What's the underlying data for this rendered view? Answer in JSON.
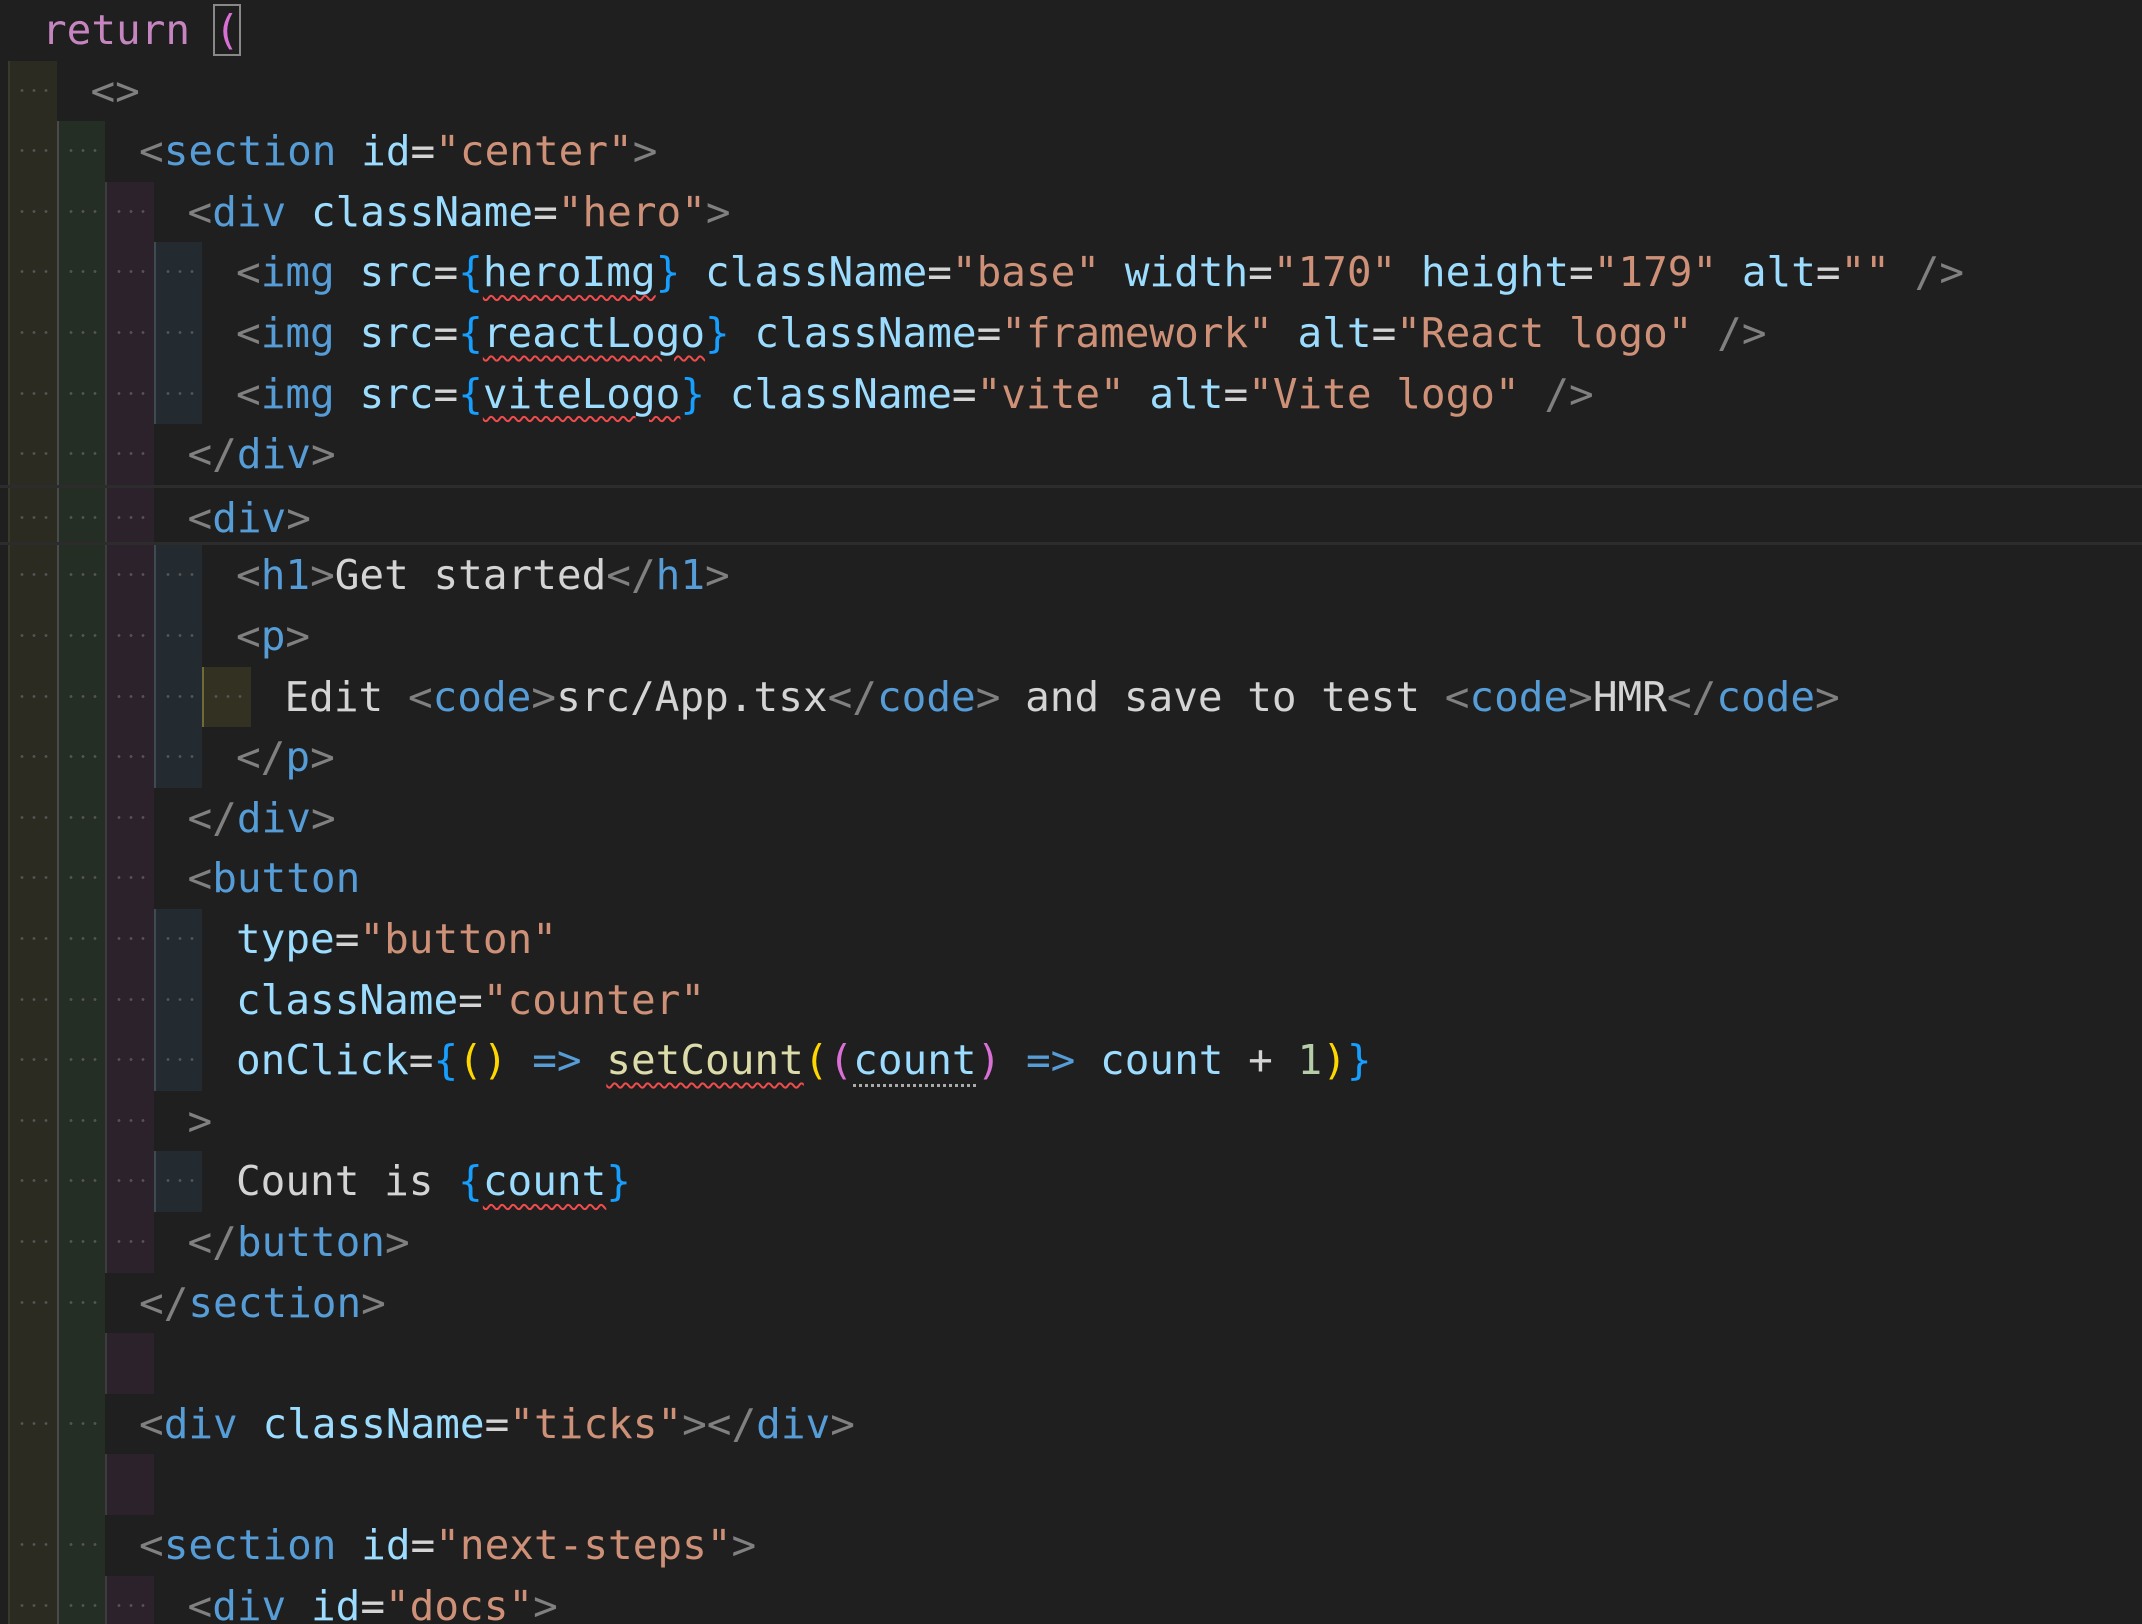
{
  "editor": {
    "language": "tsx",
    "colors": {
      "background": "#1f1f1f",
      "tag": "#569cd6",
      "attribute": "#9cdcfe",
      "string": "#ce9178",
      "keyword": "#c586c0",
      "function": "#dcdcaa",
      "number": "#b5cea8",
      "error_squiggle": "#f14c4c"
    },
    "lines": [
      {
        "indent": 0,
        "tokens": [
          {
            "t": "return",
            "c": "kw-return"
          },
          {
            "t": " ",
            "c": "ws"
          },
          {
            "t": "(",
            "c": "paren-magenta bracket-box"
          }
        ]
      },
      {
        "indent": 1,
        "tokens": [
          {
            "t": "<>",
            "c": "tag-bracket"
          }
        ]
      },
      {
        "indent": 2,
        "tokens": [
          {
            "t": "<",
            "c": "tag-bracket"
          },
          {
            "t": "section",
            "c": "tag"
          },
          {
            "t": " ",
            "c": "ws"
          },
          {
            "t": "id",
            "c": "attr"
          },
          {
            "t": "=",
            "c": "eq"
          },
          {
            "t": "\"center\"",
            "c": "str"
          },
          {
            "t": ">",
            "c": "tag-bracket"
          }
        ]
      },
      {
        "indent": 3,
        "tokens": [
          {
            "t": "<",
            "c": "tag-bracket"
          },
          {
            "t": "div",
            "c": "tag"
          },
          {
            "t": " ",
            "c": "ws"
          },
          {
            "t": "className",
            "c": "attr"
          },
          {
            "t": "=",
            "c": "eq"
          },
          {
            "t": "\"hero\"",
            "c": "str"
          },
          {
            "t": ">",
            "c": "tag-bracket"
          }
        ]
      },
      {
        "indent": 4,
        "tokens": [
          {
            "t": "<",
            "c": "tag-bracket"
          },
          {
            "t": "img",
            "c": "tag"
          },
          {
            "t": " ",
            "c": "ws"
          },
          {
            "t": "src",
            "c": "attr"
          },
          {
            "t": "=",
            "c": "eq"
          },
          {
            "t": "{",
            "c": "brace-blue"
          },
          {
            "t": "heroImg",
            "c": "ident squiggle"
          },
          {
            "t": "}",
            "c": "brace-blue"
          },
          {
            "t": " ",
            "c": "ws"
          },
          {
            "t": "className",
            "c": "attr"
          },
          {
            "t": "=",
            "c": "eq"
          },
          {
            "t": "\"base\"",
            "c": "str"
          },
          {
            "t": " ",
            "c": "ws"
          },
          {
            "t": "width",
            "c": "attr"
          },
          {
            "t": "=",
            "c": "eq"
          },
          {
            "t": "\"170\"",
            "c": "str"
          },
          {
            "t": " ",
            "c": "ws"
          },
          {
            "t": "height",
            "c": "attr"
          },
          {
            "t": "=",
            "c": "eq"
          },
          {
            "t": "\"179\"",
            "c": "str"
          },
          {
            "t": " ",
            "c": "ws"
          },
          {
            "t": "alt",
            "c": "attr"
          },
          {
            "t": "=",
            "c": "eq"
          },
          {
            "t": "\"\"",
            "c": "str"
          },
          {
            "t": " ",
            "c": "ws"
          },
          {
            "t": "/>",
            "c": "tag-bracket"
          }
        ]
      },
      {
        "indent": 4,
        "tokens": [
          {
            "t": "<",
            "c": "tag-bracket"
          },
          {
            "t": "img",
            "c": "tag"
          },
          {
            "t": " ",
            "c": "ws"
          },
          {
            "t": "src",
            "c": "attr"
          },
          {
            "t": "=",
            "c": "eq"
          },
          {
            "t": "{",
            "c": "brace-blue"
          },
          {
            "t": "reactLogo",
            "c": "ident squiggle"
          },
          {
            "t": "}",
            "c": "brace-blue"
          },
          {
            "t": " ",
            "c": "ws"
          },
          {
            "t": "className",
            "c": "attr"
          },
          {
            "t": "=",
            "c": "eq"
          },
          {
            "t": "\"framework\"",
            "c": "str"
          },
          {
            "t": " ",
            "c": "ws"
          },
          {
            "t": "alt",
            "c": "attr"
          },
          {
            "t": "=",
            "c": "eq"
          },
          {
            "t": "\"React logo\"",
            "c": "str"
          },
          {
            "t": " ",
            "c": "ws"
          },
          {
            "t": "/>",
            "c": "tag-bracket"
          }
        ]
      },
      {
        "indent": 4,
        "tokens": [
          {
            "t": "<",
            "c": "tag-bracket"
          },
          {
            "t": "img",
            "c": "tag"
          },
          {
            "t": " ",
            "c": "ws"
          },
          {
            "t": "src",
            "c": "attr"
          },
          {
            "t": "=",
            "c": "eq"
          },
          {
            "t": "{",
            "c": "brace-blue"
          },
          {
            "t": "viteLogo",
            "c": "ident squiggle"
          },
          {
            "t": "}",
            "c": "brace-blue"
          },
          {
            "t": " ",
            "c": "ws"
          },
          {
            "t": "className",
            "c": "attr"
          },
          {
            "t": "=",
            "c": "eq"
          },
          {
            "t": "\"vite\"",
            "c": "str"
          },
          {
            "t": " ",
            "c": "ws"
          },
          {
            "t": "alt",
            "c": "attr"
          },
          {
            "t": "=",
            "c": "eq"
          },
          {
            "t": "\"Vite logo\"",
            "c": "str"
          },
          {
            "t": " ",
            "c": "ws"
          },
          {
            "t": "/>",
            "c": "tag-bracket"
          }
        ]
      },
      {
        "indent": 3,
        "tokens": [
          {
            "t": "</",
            "c": "tag-bracket"
          },
          {
            "t": "div",
            "c": "tag"
          },
          {
            "t": ">",
            "c": "tag-bracket"
          }
        ]
      },
      {
        "indent": 3,
        "cursor": true,
        "tokens": [
          {
            "t": "<",
            "c": "tag-bracket"
          },
          {
            "t": "div",
            "c": "tag"
          },
          {
            "t": ">",
            "c": "tag-bracket"
          }
        ]
      },
      {
        "indent": 4,
        "tokens": [
          {
            "t": "<",
            "c": "tag-bracket"
          },
          {
            "t": "h1",
            "c": "tag"
          },
          {
            "t": ">",
            "c": "tag-bracket"
          },
          {
            "t": "Get started",
            "c": "text"
          },
          {
            "t": "</",
            "c": "tag-bracket"
          },
          {
            "t": "h1",
            "c": "tag"
          },
          {
            "t": ">",
            "c": "tag-bracket"
          }
        ]
      },
      {
        "indent": 4,
        "tokens": [
          {
            "t": "<",
            "c": "tag-bracket"
          },
          {
            "t": "p",
            "c": "tag"
          },
          {
            "t": ">",
            "c": "tag-bracket"
          }
        ]
      },
      {
        "indent": 5,
        "tokens": [
          {
            "t": "Edit",
            "c": "text"
          },
          {
            "t": " ",
            "c": "ws"
          },
          {
            "t": "<",
            "c": "tag-bracket"
          },
          {
            "t": "code",
            "c": "tag"
          },
          {
            "t": ">",
            "c": "tag-bracket"
          },
          {
            "t": "src/App.tsx",
            "c": "text"
          },
          {
            "t": "</",
            "c": "tag-bracket"
          },
          {
            "t": "code",
            "c": "tag"
          },
          {
            "t": ">",
            "c": "tag-bracket"
          },
          {
            "t": " ",
            "c": "ws"
          },
          {
            "t": "and save to test",
            "c": "text"
          },
          {
            "t": " ",
            "c": "ws"
          },
          {
            "t": "<",
            "c": "tag-bracket"
          },
          {
            "t": "code",
            "c": "tag"
          },
          {
            "t": ">",
            "c": "tag-bracket"
          },
          {
            "t": "HMR",
            "c": "text"
          },
          {
            "t": "</",
            "c": "tag-bracket"
          },
          {
            "t": "code",
            "c": "tag"
          },
          {
            "t": ">",
            "c": "tag-bracket"
          }
        ]
      },
      {
        "indent": 4,
        "tokens": [
          {
            "t": "</",
            "c": "tag-bracket"
          },
          {
            "t": "p",
            "c": "tag"
          },
          {
            "t": ">",
            "c": "tag-bracket"
          }
        ]
      },
      {
        "indent": 3,
        "tokens": [
          {
            "t": "</",
            "c": "tag-bracket"
          },
          {
            "t": "div",
            "c": "tag"
          },
          {
            "t": ">",
            "c": "tag-bracket"
          }
        ]
      },
      {
        "indent": 3,
        "tokens": [
          {
            "t": "<",
            "c": "tag-bracket"
          },
          {
            "t": "button",
            "c": "tag"
          }
        ]
      },
      {
        "indent": 4,
        "tokens": [
          {
            "t": "type",
            "c": "attr"
          },
          {
            "t": "=",
            "c": "eq"
          },
          {
            "t": "\"button\"",
            "c": "str"
          }
        ]
      },
      {
        "indent": 4,
        "tokens": [
          {
            "t": "className",
            "c": "attr"
          },
          {
            "t": "=",
            "c": "eq"
          },
          {
            "t": "\"counter\"",
            "c": "str"
          }
        ]
      },
      {
        "indent": 4,
        "tokens": [
          {
            "t": "onClick",
            "c": "attr"
          },
          {
            "t": "=",
            "c": "eq"
          },
          {
            "t": "{",
            "c": "brace-blue"
          },
          {
            "t": "()",
            "c": "paren-yellow"
          },
          {
            "t": " ",
            "c": "ws"
          },
          {
            "t": "=>",
            "c": "arrow"
          },
          {
            "t": " ",
            "c": "ws"
          },
          {
            "t": "setCount",
            "c": "func squiggle"
          },
          {
            "t": "(",
            "c": "paren-yellow"
          },
          {
            "t": "(",
            "c": "paren-magenta"
          },
          {
            "t": "count",
            "c": "ident dotted-under"
          },
          {
            "t": ")",
            "c": "paren-magenta"
          },
          {
            "t": " ",
            "c": "ws"
          },
          {
            "t": "=>",
            "c": "arrow"
          },
          {
            "t": " ",
            "c": "ws"
          },
          {
            "t": "count",
            "c": "ident"
          },
          {
            "t": " ",
            "c": "ws"
          },
          {
            "t": "+",
            "c": "op"
          },
          {
            "t": " ",
            "c": "ws"
          },
          {
            "t": "1",
            "c": "num"
          },
          {
            "t": ")",
            "c": "paren-yellow"
          },
          {
            "t": "}",
            "c": "brace-blue"
          }
        ]
      },
      {
        "indent": 3,
        "tokens": [
          {
            "t": ">",
            "c": "tag-bracket"
          }
        ]
      },
      {
        "indent": 4,
        "tokens": [
          {
            "t": "Count is",
            "c": "text"
          },
          {
            "t": " ",
            "c": "ws"
          },
          {
            "t": "{",
            "c": "brace-blue"
          },
          {
            "t": "count",
            "c": "ident squiggle"
          },
          {
            "t": "}",
            "c": "brace-blue"
          }
        ]
      },
      {
        "indent": 3,
        "tokens": [
          {
            "t": "</",
            "c": "tag-bracket"
          },
          {
            "t": "button",
            "c": "tag"
          },
          {
            "t": ">",
            "c": "tag-bracket"
          }
        ]
      },
      {
        "indent": 2,
        "tokens": [
          {
            "t": "</",
            "c": "tag-bracket"
          },
          {
            "t": "section",
            "c": "tag"
          },
          {
            "t": ">",
            "c": "tag-bracket"
          }
        ]
      },
      {
        "indent": 0,
        "empty": true,
        "tokens": []
      },
      {
        "indent": 2,
        "tokens": [
          {
            "t": "<",
            "c": "tag-bracket"
          },
          {
            "t": "div",
            "c": "tag"
          },
          {
            "t": " ",
            "c": "ws"
          },
          {
            "t": "className",
            "c": "attr"
          },
          {
            "t": "=",
            "c": "eq"
          },
          {
            "t": "\"ticks\"",
            "c": "str"
          },
          {
            "t": "></",
            "c": "tag-bracket"
          },
          {
            "t": "div",
            "c": "tag"
          },
          {
            "t": ">",
            "c": "tag-bracket"
          }
        ]
      },
      {
        "indent": 0,
        "empty": true,
        "tokens": []
      },
      {
        "indent": 2,
        "tokens": [
          {
            "t": "<",
            "c": "tag-bracket"
          },
          {
            "t": "section",
            "c": "tag"
          },
          {
            "t": " ",
            "c": "ws"
          },
          {
            "t": "id",
            "c": "attr"
          },
          {
            "t": "=",
            "c": "eq"
          },
          {
            "t": "\"next-steps\"",
            "c": "str"
          },
          {
            "t": ">",
            "c": "tag-bracket"
          }
        ]
      },
      {
        "indent": 3,
        "tokens": [
          {
            "t": "<",
            "c": "tag-bracket"
          },
          {
            "t": "div",
            "c": "tag"
          },
          {
            "t": " ",
            "c": "ws"
          },
          {
            "t": "id",
            "c": "attr"
          },
          {
            "t": "=",
            "c": "eq"
          },
          {
            "t": "\"docs\"",
            "c": "str"
          },
          {
            "t": ">",
            "c": "tag-bracket"
          }
        ]
      }
    ]
  }
}
